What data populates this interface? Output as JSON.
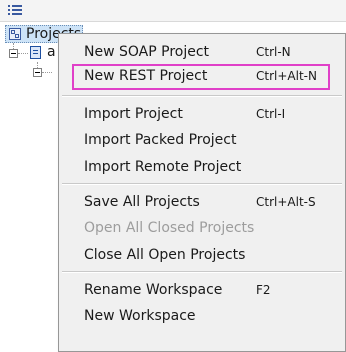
{
  "tree": {
    "root_label": "Projects",
    "child_label": "a"
  },
  "menu": {
    "items": [
      {
        "label": "New SOAP Project",
        "shortcut": "Ctrl-N"
      },
      {
        "label": "New REST Project",
        "shortcut": "Ctrl+Alt-N"
      },
      {
        "label": "Import Project",
        "shortcut": "Ctrl-I"
      },
      {
        "label": "Import Packed Project",
        "shortcut": ""
      },
      {
        "label": "Import Remote Project",
        "shortcut": ""
      },
      {
        "label": "Save All Projects",
        "shortcut": "Ctrl+Alt-S"
      },
      {
        "label": "Open All Closed Projects",
        "shortcut": ""
      },
      {
        "label": "Close All Open Projects",
        "shortcut": ""
      },
      {
        "label": "Rename Workspace",
        "shortcut": "F2"
      },
      {
        "label": "New Workspace",
        "shortcut": ""
      }
    ]
  },
  "colors": {
    "highlight_outline": "#e040c8",
    "selection_bg": "#cde3f7"
  }
}
